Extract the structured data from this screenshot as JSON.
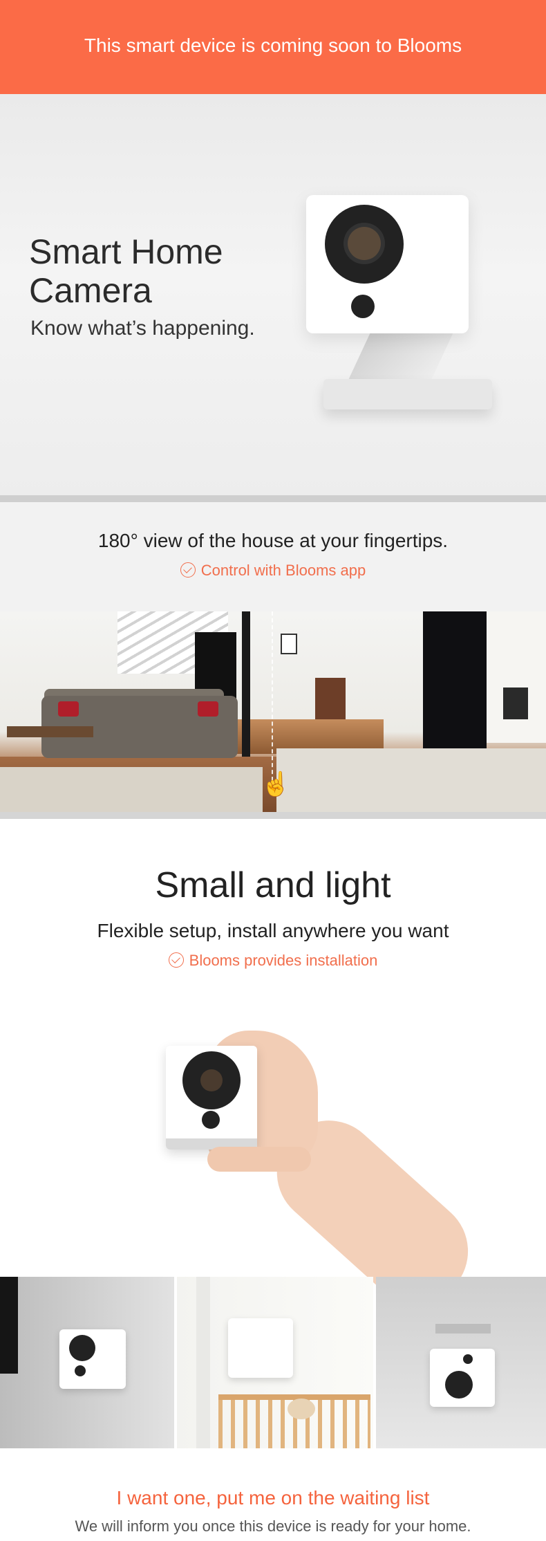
{
  "banner": {
    "text": "This smart device is coming soon to Blooms",
    "color": "#fb6b47"
  },
  "hero": {
    "title": "Smart Home\nCamera",
    "subtitle": "Know what’s happening."
  },
  "view_section": {
    "title": "180° view of the house at your fingertips.",
    "feature": "Control with Blooms app",
    "feature_icon": "check-circle-icon"
  },
  "room_image": {
    "pan_icon": "hand-swipe-icon"
  },
  "small_section": {
    "title": "Small and light",
    "subtitle": "Flexible setup, install anywhere you want",
    "feature": "Blooms provides installation",
    "feature_icon": "check-circle-icon"
  },
  "waiting_list": {
    "cta": "I want one, put me on the waiting list",
    "note": "We will inform you once this device is ready for your home.",
    "accent": "#f5633d"
  }
}
